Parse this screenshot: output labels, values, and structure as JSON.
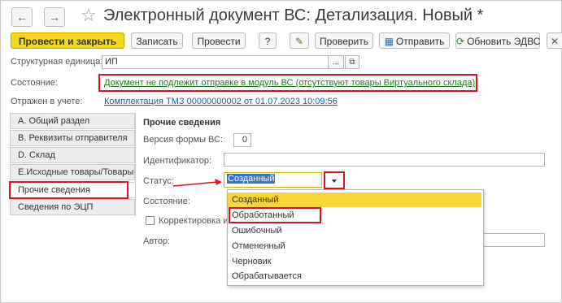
{
  "window": {
    "title": "Электронный документ ВС: Детализация. Новый *",
    "back_icon": "←",
    "forward_icon": "→",
    "star_icon": "☆"
  },
  "toolbar": {
    "post_close": "Провести и закрыть",
    "save": "Записать",
    "post": "Провести",
    "help": "?",
    "edit_icon": "✎",
    "check": "Проверить",
    "send": "Отправить",
    "refresh": "Обновить ЭДВС",
    "close_icon": "✕"
  },
  "header": {
    "unit_label": "Структурная единица:",
    "unit_value": "ИП",
    "unit_select_btn": "...",
    "unit_open_btn": "⧉",
    "state_label": "Состояние:",
    "state_link": "Документ не подлежит отправке в модуль ВС (отсутствуют товары Виртуального склада)",
    "reflected_label": "Отражен в учете:",
    "reflected_link": "Комплектация ТМЗ 00000000002 от 01.07.2023 10:09:56"
  },
  "tabs": [
    {
      "label": "А. Общий раздел"
    },
    {
      "label": "В. Реквизиты отправителя"
    },
    {
      "label": "D. Склад"
    },
    {
      "label": "E.Исходные товары/Товары"
    },
    {
      "label": "Прочие сведения"
    },
    {
      "label": "Сведения по ЭЦП"
    }
  ],
  "other_info": {
    "title": "Прочие сведения",
    "form_version_label": "Версия формы ВС:",
    "form_version_value": "0",
    "identifier_label": "Идентификатор:",
    "identifier_value": "",
    "status_label": "Статус:",
    "status_value": "Созданный",
    "state_label": "Состояние:",
    "correction_label": "Корректировка и",
    "author_label": "Автор:"
  },
  "status_options": [
    "Созданный",
    "Обработанный",
    "Ошибочный",
    "Отмененный",
    "Черновик",
    "Обрабатывается"
  ],
  "colors": {
    "primary_button": "#f5d71c",
    "selected_option": "#f7d63a",
    "highlight_red": "#e0101a",
    "link_blue": "#1a5fa8",
    "link_green": "#1f7a1f"
  }
}
